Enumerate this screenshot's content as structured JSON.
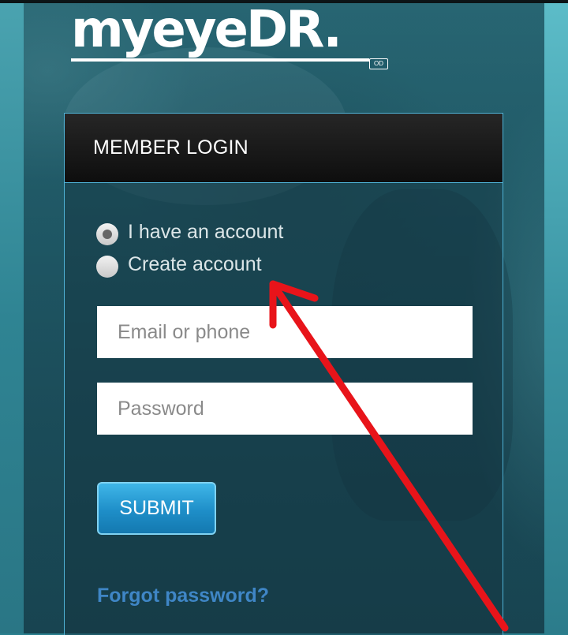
{
  "brand": {
    "logo_text": "myeyeDR.",
    "logo_badge": "OD"
  },
  "login": {
    "title": "MEMBER LOGIN",
    "options": [
      {
        "label": "I have an account",
        "selected": true
      },
      {
        "label": "Create account",
        "selected": false
      }
    ],
    "email_placeholder": "Email or phone",
    "password_placeholder": "Password",
    "submit_label": "SUBMIT",
    "forgot_label": "Forgot password?"
  },
  "annotation": {
    "arrow_color": "#e8141a"
  },
  "colors": {
    "header_bg": "#111111",
    "box_border": "#4fb2d6",
    "submit_bg": "#1e8ec8",
    "forgot_link": "#3f86c6"
  }
}
